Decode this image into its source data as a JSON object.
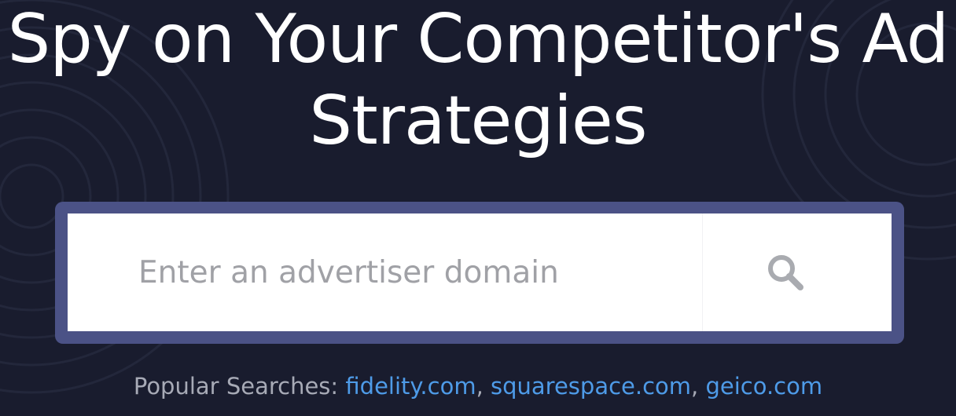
{
  "hero": {
    "title_line1": "Spy on Your Competitor's Ad",
    "title_line2": "Strategies"
  },
  "search": {
    "placeholder": "Enter an advertiser domain",
    "value": "",
    "button_icon": "search-icon"
  },
  "popular": {
    "label": "Popular Searches:",
    "links": [
      {
        "text": "fidelity.com"
      },
      {
        "text": "squarespace.com"
      },
      {
        "text": "geico.com"
      }
    ]
  },
  "colors": {
    "background": "#191c2e",
    "frame": "#4b5286",
    "link": "#4e9be8",
    "title": "#ffffff"
  }
}
